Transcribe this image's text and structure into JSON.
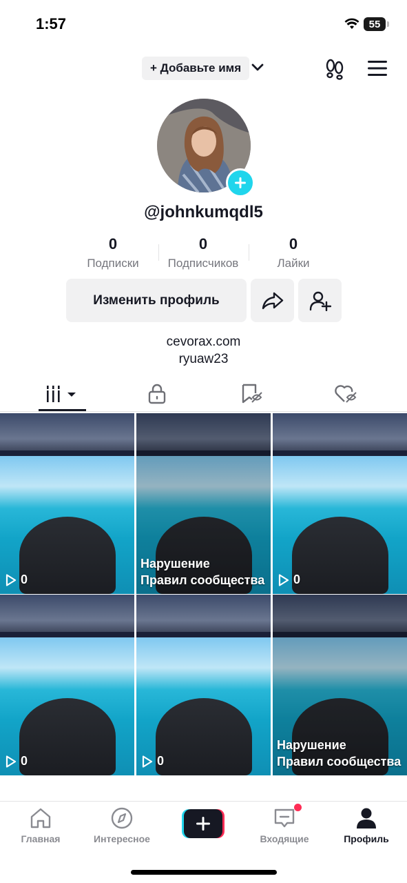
{
  "status_bar": {
    "time": "1:57",
    "battery": "55"
  },
  "header": {
    "add_name": "+ Добавьте имя"
  },
  "profile": {
    "username": "@johnkumqdl5"
  },
  "stats": [
    {
      "value": "0",
      "label": "Подписки"
    },
    {
      "value": "0",
      "label": "Подписчиков"
    },
    {
      "value": "0",
      "label": "Лайки"
    }
  ],
  "actions": {
    "edit_profile": "Изменить профиль"
  },
  "bio": {
    "line1": "cevorax.com",
    "line2": "ryuaw23"
  },
  "grid": [
    {
      "views": "0",
      "violation": ""
    },
    {
      "views": "",
      "violation_line1": "Нарушение",
      "violation_line2": "Правил сообщества"
    },
    {
      "views": "0",
      "violation": ""
    },
    {
      "views": "0",
      "violation": ""
    },
    {
      "views": "0",
      "violation": ""
    },
    {
      "views": "",
      "violation_line1": "Нарушение",
      "violation_line2": "Правил сообщества"
    }
  ],
  "nav": {
    "home": "Главная",
    "discover": "Интересное",
    "inbox": "Входящие",
    "profile": "Профиль"
  },
  "colors": {
    "accent_cyan": "#20d5ec",
    "accent_red": "#fe2c55",
    "text": "#161823"
  },
  "icons": [
    "wifi-icon",
    "chevron-down-icon",
    "footprints-icon",
    "menu-icon",
    "plus-icon",
    "share-icon",
    "add-friend-icon",
    "videos-grid-icon",
    "lock-icon",
    "bookmark-icon",
    "heart-icon",
    "play-icon",
    "home-icon",
    "compass-icon",
    "inbox-icon",
    "profile-icon"
  ]
}
